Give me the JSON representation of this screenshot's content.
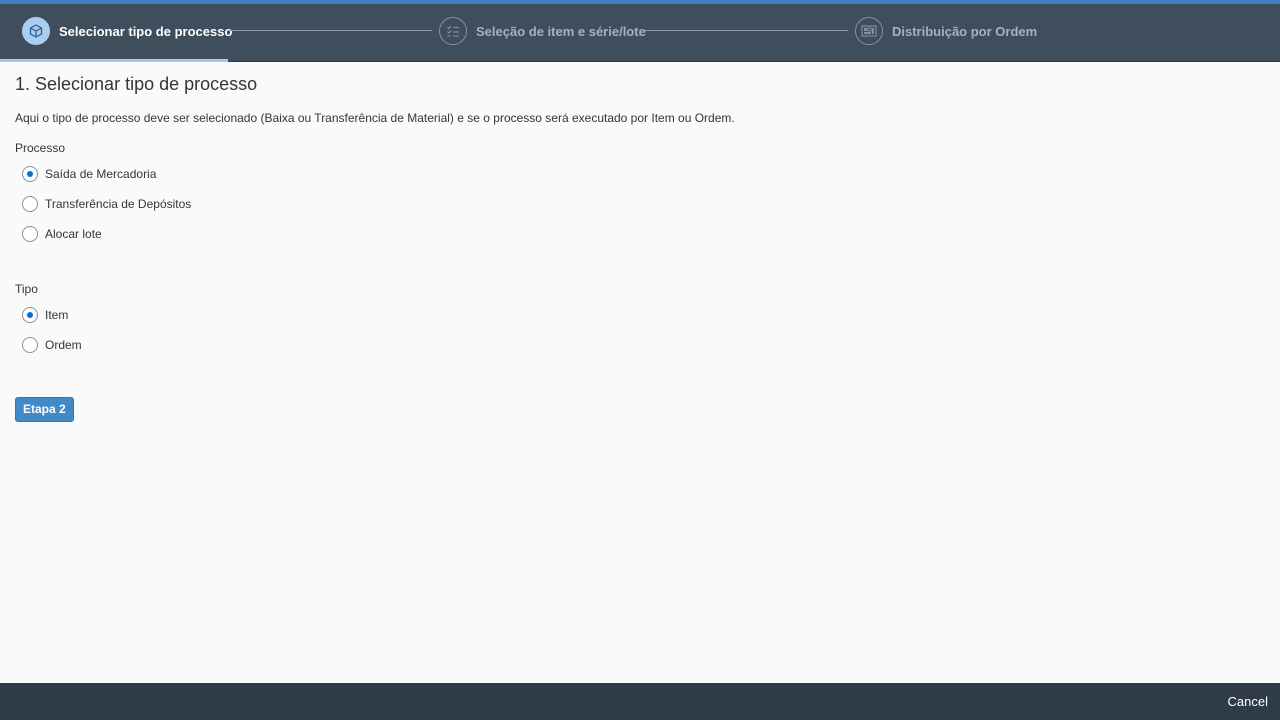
{
  "wizard": {
    "steps": [
      {
        "label": "Selecionar tipo de processo",
        "icon": "cube-icon",
        "state": "active"
      },
      {
        "label": "Seleção de item e série/lote",
        "icon": "checklist-icon",
        "state": "inactive"
      },
      {
        "label": "Distribuição por Ordem",
        "icon": "distribution-icon",
        "state": "inactive"
      }
    ]
  },
  "main": {
    "title": "1. Selecionar tipo de processo",
    "description": "Aqui o tipo de processo deve ser selecionado (Baixa ou Transferência de Material) e se o processo será executado por Item ou Ordem.",
    "process_group": {
      "label": "Processo",
      "options": [
        {
          "label": "Saída de Mercadoria",
          "checked": true
        },
        {
          "label": "Transferência de Depósitos",
          "checked": false
        },
        {
          "label": "Alocar lote",
          "checked": false
        }
      ]
    },
    "type_group": {
      "label": "Tipo",
      "options": [
        {
          "label": "Item",
          "checked": true
        },
        {
          "label": "Ordem",
          "checked": false
        }
      ]
    },
    "next_button": "Etapa 2"
  },
  "footer": {
    "cancel_label": "Cancel"
  },
  "colors": {
    "header_bg": "#3f4d5c",
    "accent": "#3d7fc1",
    "button": "#428ac6",
    "footer_bg": "#2f3b48"
  }
}
